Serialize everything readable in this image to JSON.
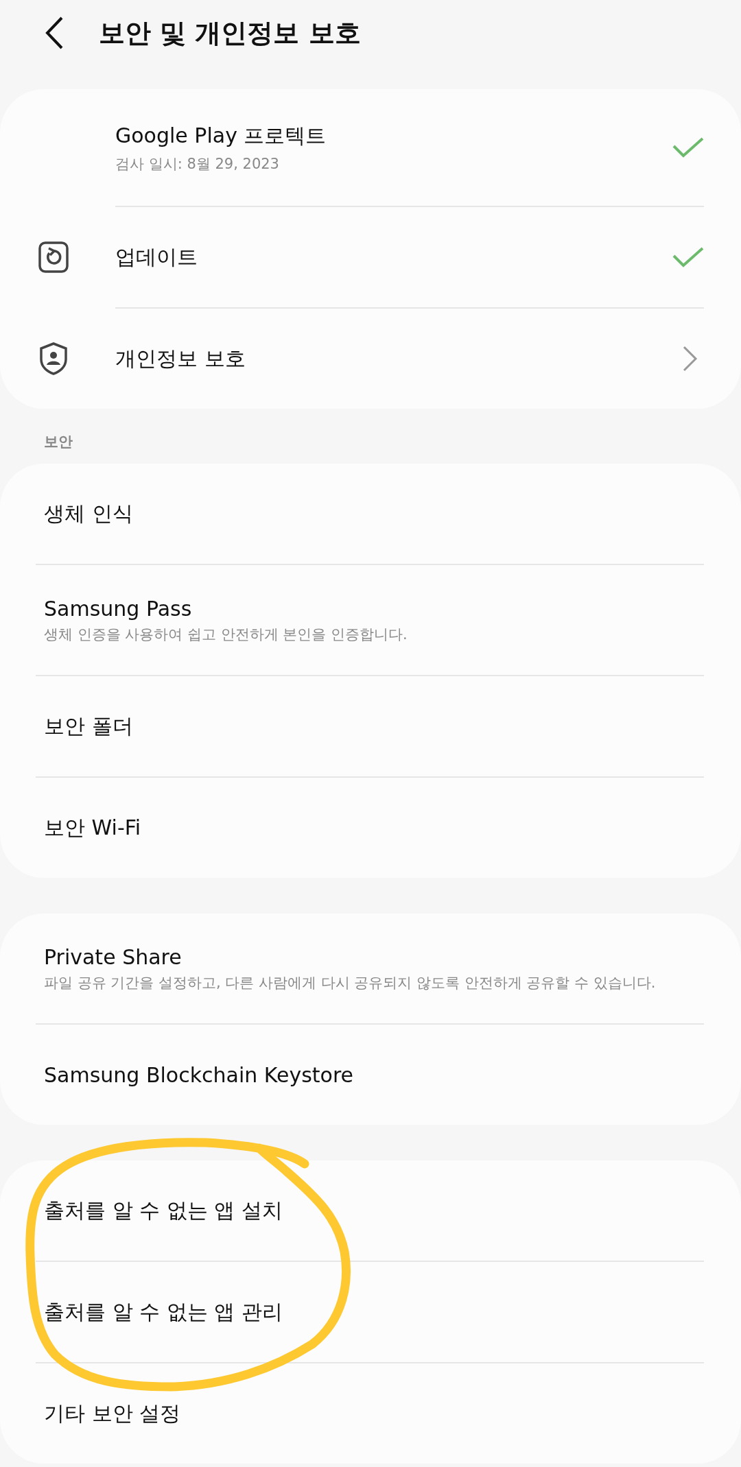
{
  "header": {
    "title": "보안 및 개인정보 보호"
  },
  "top_card": [
    {
      "title": "Google Play 프로텍트",
      "subtitle": "검사 일시: 8월 29, 2023",
      "kind": "status"
    },
    {
      "title": "업데이트",
      "kind": "status"
    },
    {
      "title": "개인정보 보호",
      "kind": "link"
    }
  ],
  "section_label": "보안",
  "groups": [
    [
      {
        "title": "생체 인식"
      },
      {
        "title": "Samsung Pass",
        "subtitle": "생체 인증을 사용하여 쉽고 안전하게 본인을 인증합니다."
      },
      {
        "title": "보안 폴더"
      },
      {
        "title": "보안 Wi-Fi"
      }
    ],
    [
      {
        "title": "Private Share",
        "subtitle": "파일 공유 기간을 설정하고, 다른 사람에게 다시 공유되지 않도록 안전하게 공유할 수 있습니다."
      },
      {
        "title": "Samsung Blockchain Keystore"
      }
    ],
    [
      {
        "title": "출처를 알 수 없는 앱 설치"
      },
      {
        "title": "출처를 알 수 없는 앱 관리"
      },
      {
        "title": "기타 보안 설정"
      }
    ]
  ],
  "annotation": {
    "kind": "circle"
  }
}
